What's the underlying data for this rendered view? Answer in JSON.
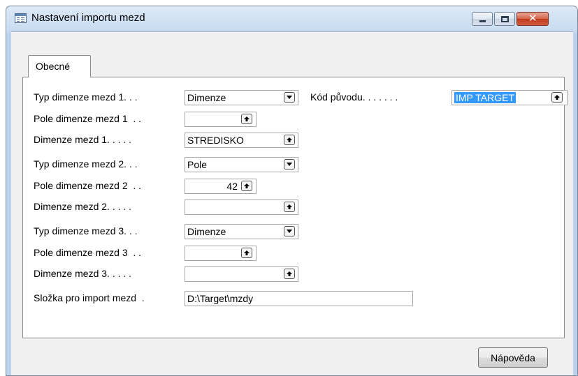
{
  "window": {
    "title": "Nastavení importu mezd"
  },
  "tabs": [
    {
      "label": "Obecné"
    }
  ],
  "form": {
    "rows": [
      {
        "label": "Typ dimenze mezd 1. . . ",
        "value": "Dimenze",
        "control": "dropdown"
      },
      {
        "label": "Pole dimenze mezd 1  . . ",
        "value": "",
        "control": "lookup"
      },
      {
        "label": "Dimenze mezd 1. . . . . ",
        "value": "STREDISKO",
        "control": "lookup"
      },
      {
        "label": "Typ dimenze mezd 2. . . ",
        "value": "Pole",
        "control": "dropdown"
      },
      {
        "label": "Pole dimenze mezd 2  . . ",
        "value": "42",
        "control": "lookup"
      },
      {
        "label": "Dimenze mezd 2. . . . . ",
        "value": "",
        "control": "lookup"
      },
      {
        "label": "Typ dimenze mezd 3. . . ",
        "value": "Dimenze",
        "control": "dropdown"
      },
      {
        "label": "Pole dimenze mezd 3  . . ",
        "value": "",
        "control": "lookup"
      },
      {
        "label": "Dimenze mezd 3. . . . . ",
        "value": "",
        "control": "lookup"
      },
      {
        "label": "Složka pro import mezd  . ",
        "value": "D:\\Target\\mzdy",
        "control": "text"
      }
    ],
    "source_code": {
      "label": "Kód původu. . . . . . . ",
      "value": "IMP TARGET",
      "selected": true
    }
  },
  "buttons": {
    "help": "Nápověda"
  }
}
